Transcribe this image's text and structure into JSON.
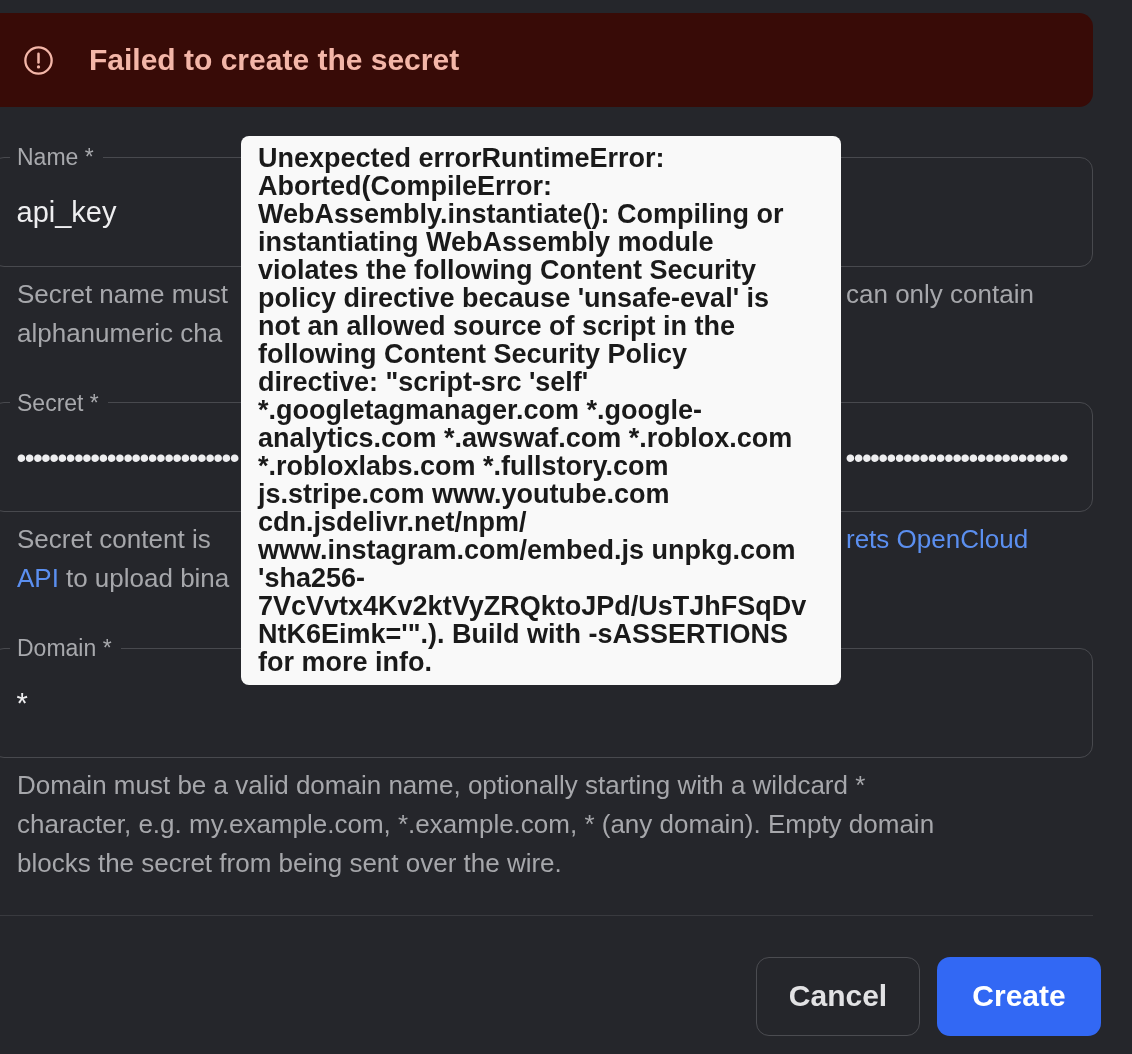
{
  "error_banner": {
    "message": "Failed to create the secret"
  },
  "fields": [
    {
      "label": "Name *",
      "value": "api_key",
      "helper_lines": [
        {
          "left": [
            {
              "kind": "text",
              "text": "Secret name must"
            }
          ],
          "right": [
            {
              "kind": "text",
              "text": "can only contain"
            }
          ]
        },
        {
          "left": [
            {
              "kind": "text",
              "text": "alphanumeric cha"
            }
          ]
        }
      ]
    },
    {
      "label": "Secret *",
      "value": {
        "left": "•••••••••••••••••••••••••••",
        "right": "•••••••••••••••••••••••••••"
      },
      "helper_lines": [
        {
          "left": [
            {
              "kind": "text",
              "text": "Secret content is"
            }
          ],
          "right": [
            {
              "kind": "link",
              "text": "rets OpenCloud"
            }
          ]
        },
        {
          "left": [
            {
              "kind": "link",
              "text": "API"
            },
            {
              "kind": "text",
              "text": "to upload bina"
            }
          ]
        }
      ]
    },
    {
      "label": "Domain *",
      "value": "*",
      "helper": "Domain must be a valid domain name, optionally starting with a wildcard * character, e.g. my.example.com, *.example.com, * (any domain). Empty domain blocks the secret from being sent over the wire."
    }
  ],
  "tooltip": {
    "text": "Unexpected errorRuntimeError: Aborted(CompileError: WebAssembly.instantiate(): Compiling or instantiating WebAssembly module violates the following Content Security policy directive because 'unsafe-eval' is not an allowed source of script in the following Content Security Policy directive: \"script-src 'self' *.googletagmanager.com *.google-analytics.com *.awswaf.com *.roblox.com *.robloxlabs.com *.fullstory.com js.stripe.com www.youtube.com cdn.jsdelivr.net/npm/ www.instagram.com/embed.js unpkg.com 'sha256-7VcVvtx4Kv2ktVyZRQktoJPd/UsTJhFSqDvNtK6Eimk='\".). Build with -sASSERTIONS for more info."
  },
  "buttons": [
    {
      "label": "Cancel",
      "kind": "secondary"
    },
    {
      "label": "Create",
      "kind": "primary"
    }
  ]
}
